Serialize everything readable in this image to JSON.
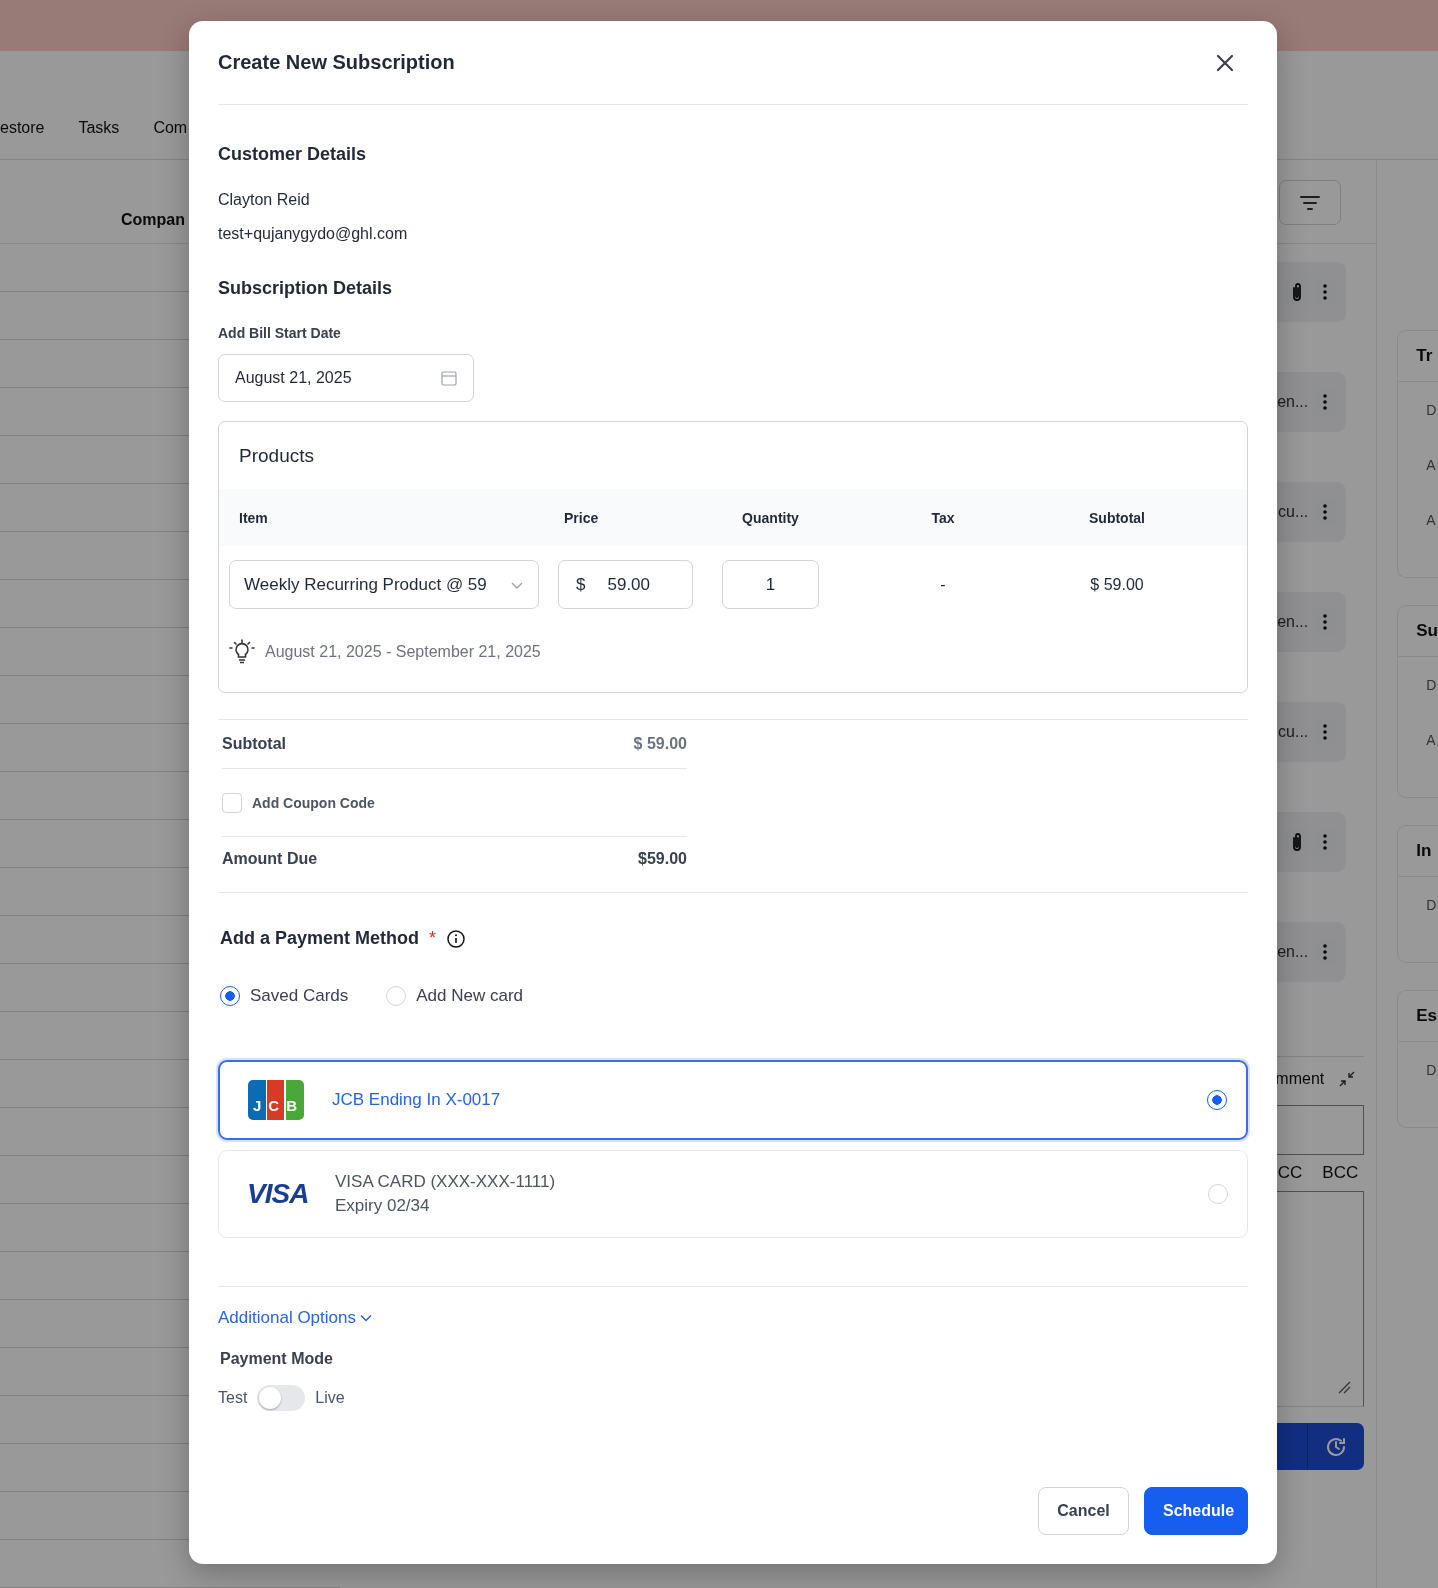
{
  "background": {
    "nav_tabs": [
      "estore",
      "Tasks",
      "Com"
    ],
    "table_header": "Compan",
    "activity_items": [
      {
        "attachment": true
      },
      {
        "text": "en...",
        "attachment": false
      },
      {
        "text": "cu...",
        "attachment": false
      },
      {
        "text": "en...",
        "attachment": false
      },
      {
        "text": "cu...",
        "attachment": false
      },
      {
        "attachment": true
      },
      {
        "text": "en...",
        "attachment": false
      }
    ],
    "sidebar_cards": [
      {
        "title": "Tr",
        "rows": [
          "D",
          "A",
          "A"
        ]
      },
      {
        "title": "Su",
        "rows": [
          "D",
          "A"
        ]
      },
      {
        "title": "In",
        "rows": [
          "D"
        ]
      },
      {
        "title": "Es",
        "rows": [
          "D"
        ]
      }
    ],
    "comment": {
      "title": "mment",
      "cc": "CC",
      "bcc": "BCC"
    }
  },
  "modal": {
    "title": "Create New Subscription",
    "customer": {
      "heading": "Customer Details",
      "name": "Clayton Reid",
      "email": "test+qujanygydo@ghl.com"
    },
    "subscription": {
      "heading": "Subscription Details",
      "start_date_label": "Add Bill Start Date",
      "start_date": "August 21, 2025"
    },
    "products": {
      "title": "Products",
      "columns": [
        "Item",
        "Price",
        "Quantity",
        "Tax",
        "Subtotal"
      ],
      "rows": [
        {
          "item": "Weekly Recurring Product @ 59",
          "currency": "$",
          "price": "59.00",
          "quantity": "1",
          "tax": "-",
          "subtotal": "$ 59.00",
          "period": "August 21, 2025 - September 21, 2025"
        }
      ]
    },
    "summary": {
      "subtotal_label": "Subtotal",
      "subtotal": "$ 59.00",
      "coupon_label": "Add Coupon Code",
      "coupon_checked": false,
      "amount_due_label": "Amount Due",
      "amount_due": "$59.00"
    },
    "payment": {
      "heading": "Add a Payment Method",
      "required_mark": "*",
      "options": [
        {
          "label": "Saved Cards",
          "selected": true
        },
        {
          "label": "Add New card",
          "selected": false
        }
      ],
      "cards": [
        {
          "kind": "jcb",
          "logo": "JCB",
          "title": "JCB Ending In X-0017",
          "selected": true
        },
        {
          "kind": "visa",
          "logo": "VISA",
          "title": "VISA CARD (XXX-XXX-1111)",
          "expiry": "Expiry 02/34",
          "selected": false
        }
      ]
    },
    "additional_options": {
      "label": "Additional Options",
      "expanded": true
    },
    "payment_mode": {
      "label": "Payment Mode",
      "off_label": "Test",
      "on_label": "Live",
      "on": false
    },
    "buttons": [
      {
        "label": "Cancel",
        "kind": "secondary"
      },
      {
        "label": "Schedule",
        "kind": "primary"
      }
    ]
  }
}
